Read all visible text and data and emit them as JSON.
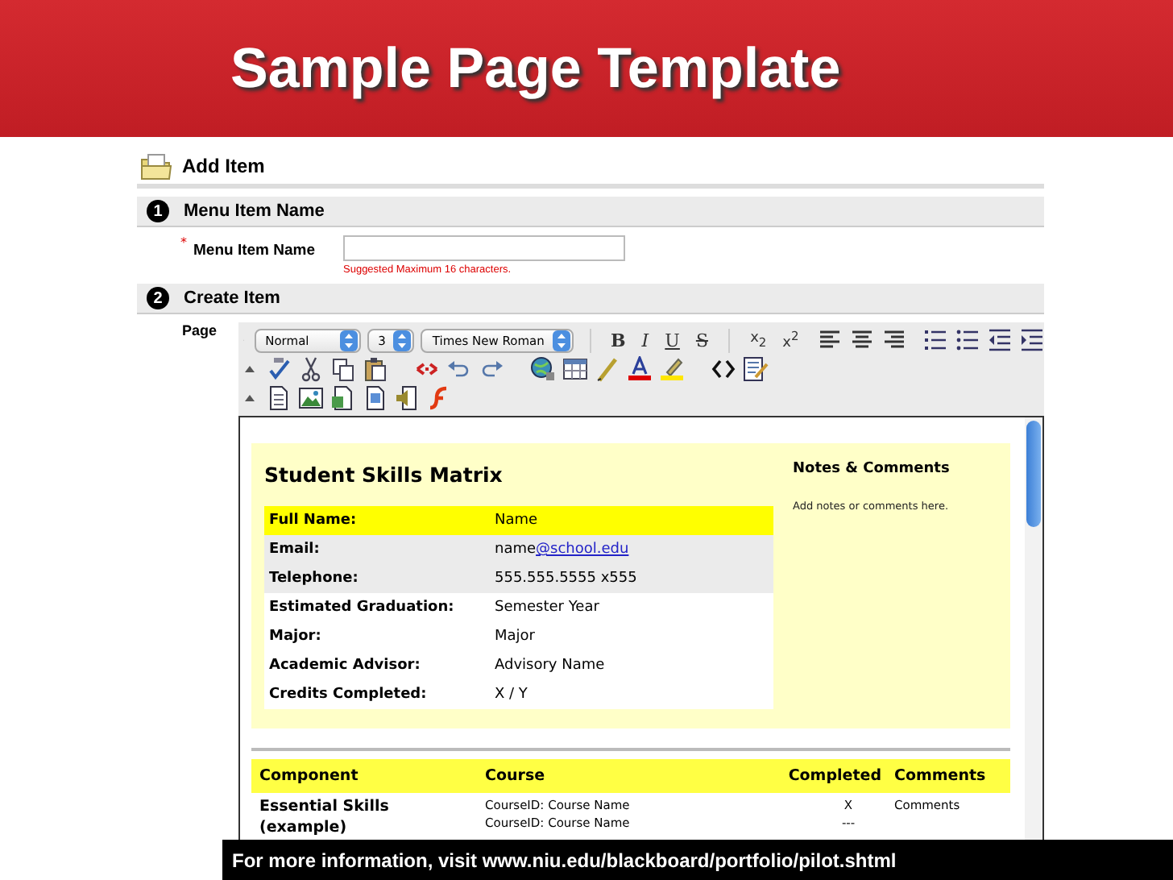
{
  "slide": {
    "title": "Sample Page Template",
    "footer": "For more information, visit www.niu.edu/blackboard/portfolio/pilot.shtml"
  },
  "page": {
    "title": "Add Item",
    "sections": [
      {
        "number": "1",
        "title": "Menu Item Name"
      },
      {
        "number": "2",
        "title": "Create Item"
      }
    ],
    "field": {
      "required_mark": "*",
      "label": "Menu Item Name",
      "hint": "Suggested Maximum 16 characters."
    },
    "editor": {
      "label": "Page",
      "selects": [
        {
          "value": "Normal"
        },
        {
          "value": "3"
        },
        {
          "value": "Times New Roman"
        }
      ],
      "format_buttons": [
        {
          "kind": "bold",
          "label": "B"
        },
        {
          "kind": "italic",
          "label": "I"
        },
        {
          "kind": "underline",
          "label": "U"
        },
        {
          "kind": "strike",
          "label": "S"
        }
      ],
      "script_buttons": [
        "x$_{2}$",
        "x$^{2}$"
      ],
      "content": {
        "matrix_title": "Student Skills Matrix",
        "notes_title": "Notes & Comments",
        "notes_text": "Add notes or comments here.",
        "rows": [
          {
            "label": "Full Name:",
            "value": "Name",
            "color": "#ffff00"
          },
          {
            "label": "Email:",
            "value": "name",
            "link": "@school.edu",
            "color": "#ebebeb"
          },
          {
            "label": "Telephone:",
            "value": "555.555.5555 x555",
            "color": "#ebebeb"
          },
          {
            "label": "Estimated Graduation:",
            "value": "Semester Year",
            "color": "#ffffff"
          },
          {
            "label": "Major:",
            "value": "Major",
            "color": "#ffffff"
          },
          {
            "label": "Academic Advisor:",
            "value": "Advisory Name",
            "color": "#ffffff"
          },
          {
            "label": "Credits Completed:",
            "value": "X / Y",
            "color": "#ffffff"
          }
        ],
        "course_table": {
          "columns": [
            "Component",
            "Course",
            "Completed",
            "Comments"
          ],
          "rows": [
            {
              "component": "Essential Skills (example)",
              "courses": [
                "CourseID: Course Name",
                "CourseID: Course Name"
              ],
              "completed": [
                "X",
                "---"
              ],
              "comments": "Comments"
            }
          ]
        }
      }
    }
  }
}
